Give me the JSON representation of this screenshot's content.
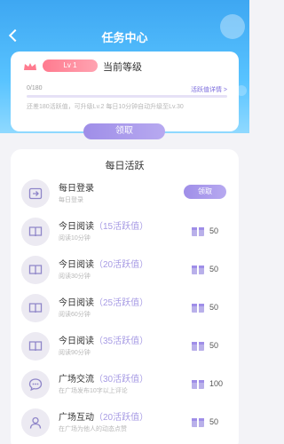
{
  "header": {
    "title": "任务中心"
  },
  "level_card": {
    "badge": "Lv 1",
    "label": "当前等级",
    "progress_text": "0/180",
    "progress_fraction": 0.0,
    "link": "活跃值详情 >",
    "description": "还差180活跃值，可升级Lv.2 每日10分钟自动升级至Lv.30"
  },
  "claim_main_label": "领取",
  "daily": {
    "title": "每日活跃",
    "tasks": [
      {
        "title": "每日登录",
        "points": "",
        "subtitle": "每日登录",
        "icon": "login-icon",
        "action": "领取"
      },
      {
        "title": "今日阅读",
        "points": "（15活跃值）",
        "subtitle": "阅读10分钟",
        "icon": "book-icon",
        "reward": "50"
      },
      {
        "title": "今日阅读",
        "points": "（20活跃值）",
        "subtitle": "阅读30分钟",
        "icon": "book-icon",
        "reward": "50"
      },
      {
        "title": "今日阅读",
        "points": "（25活跃值）",
        "subtitle": "阅读60分钟",
        "icon": "book-icon",
        "reward": "50"
      },
      {
        "title": "今日阅读",
        "points": "（35活跃值）",
        "subtitle": "阅读90分钟",
        "icon": "book-icon",
        "reward": "50"
      },
      {
        "title": "广场交流",
        "points": "（30活跃值）",
        "subtitle": "在广场发布10字以上评论",
        "icon": "chat-icon",
        "reward": "100"
      },
      {
        "title": "广场互动",
        "points": "（20活跃值）",
        "subtitle": "在广场为他人的动态点赞",
        "icon": "user-icon",
        "reward": "50"
      }
    ]
  },
  "colors": {
    "accent": "#9f8ee8",
    "header": "#3ea7f2",
    "badge": "#ff7b8f"
  }
}
